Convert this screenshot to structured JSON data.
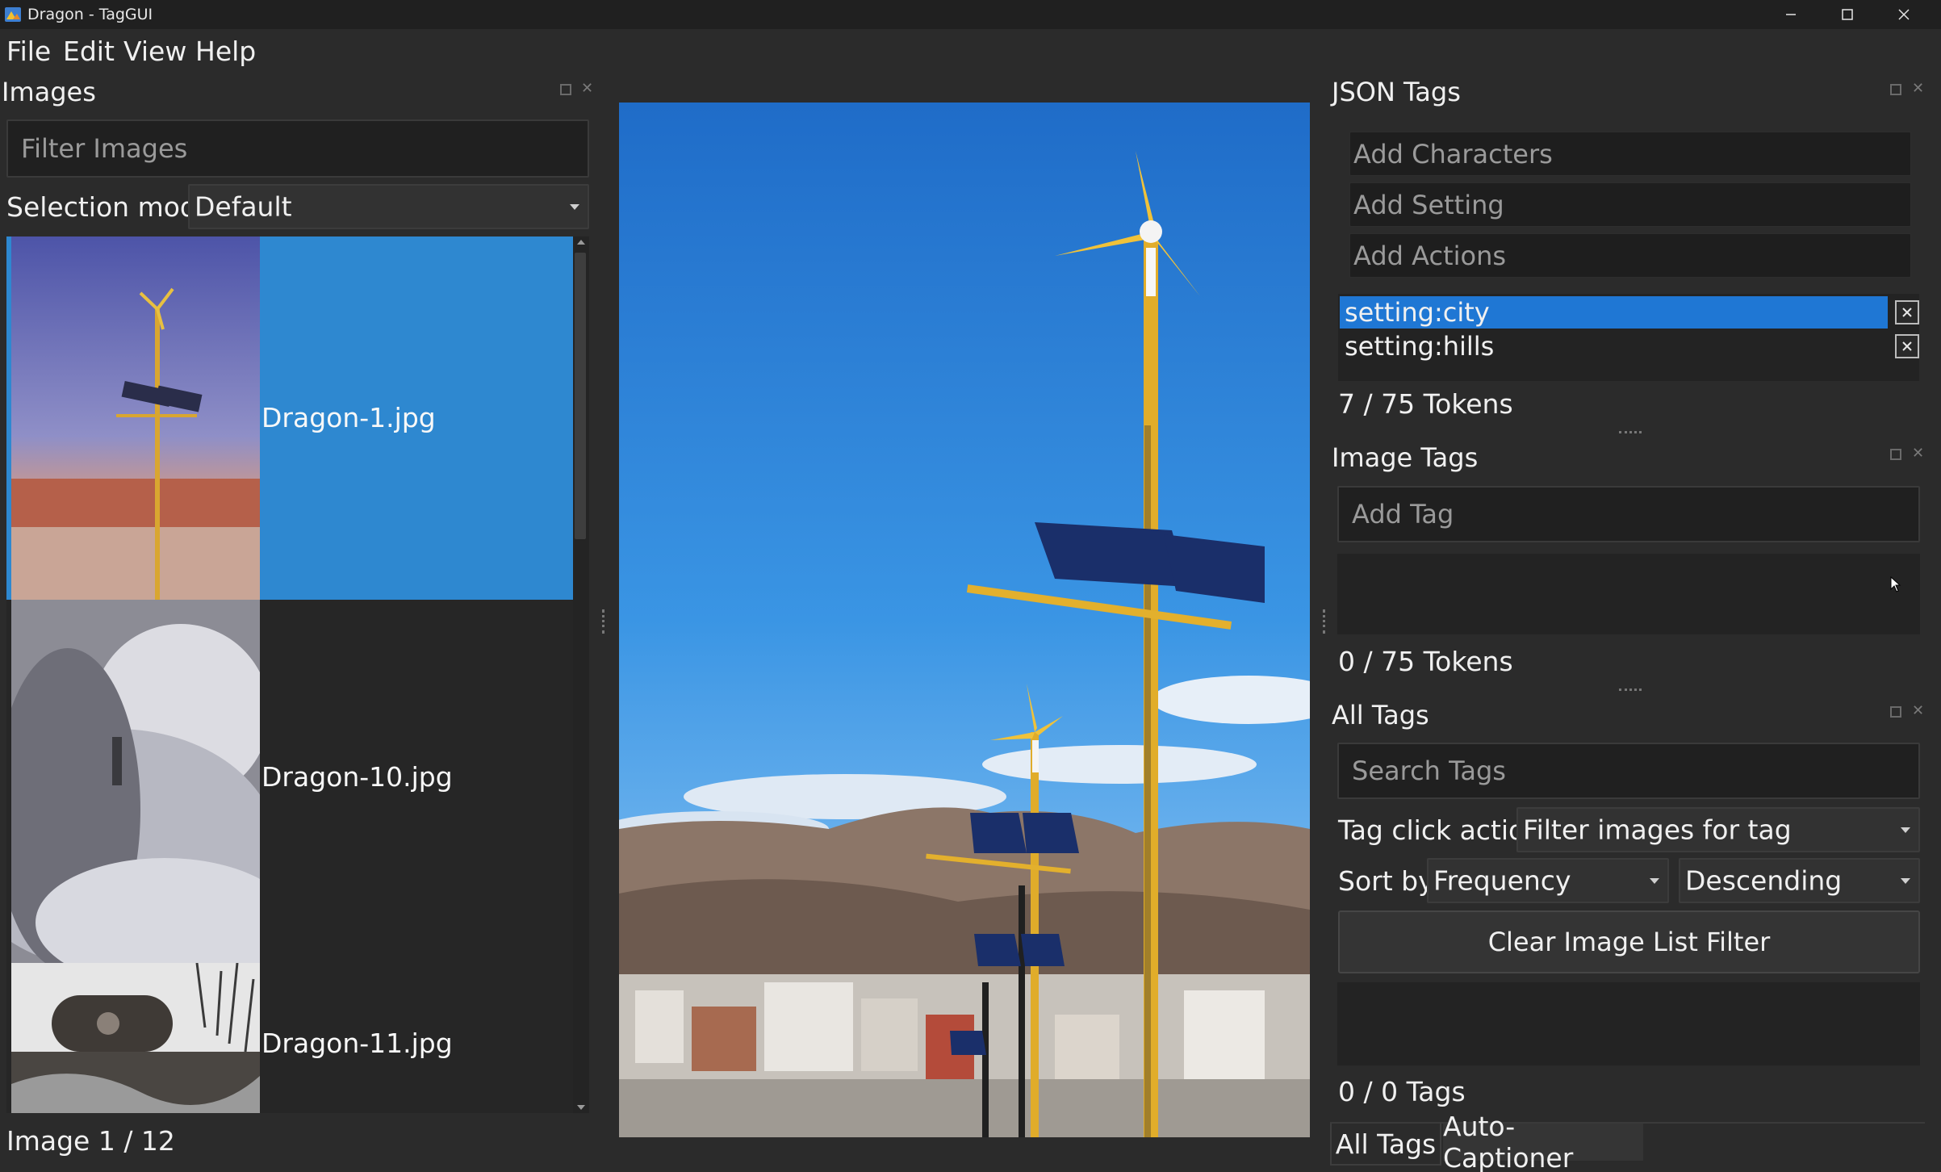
{
  "window": {
    "title": "Dragon - TagGUI"
  },
  "menu": [
    "File",
    "Edit",
    "View",
    "Help"
  ],
  "images_panel": {
    "title": "Images",
    "filter_placeholder": "Filter Images",
    "selection_mode_label": "Selection mode",
    "selection_mode_value": "Default",
    "items": [
      {
        "name": "Dragon-1.jpg",
        "selected": true
      },
      {
        "name": "Dragon-10.jpg",
        "selected": false
      },
      {
        "name": "Dragon-11.jpg",
        "selected": false
      }
    ],
    "status": "Image 1 / 12"
  },
  "json_tags_panel": {
    "title": "JSON Tags",
    "add_characters_placeholder": "Add Characters",
    "add_setting_placeholder": "Add Setting",
    "add_actions_placeholder": "Add Actions",
    "tags": [
      {
        "label": "setting:city",
        "selected": true
      },
      {
        "label": "setting:hills",
        "selected": false
      }
    ],
    "token_count": "7 / 75 Tokens"
  },
  "image_tags_panel": {
    "title": "Image Tags",
    "add_tag_placeholder": "Add Tag",
    "token_count": "0 / 75 Tokens"
  },
  "all_tags_panel": {
    "title": "All Tags",
    "search_placeholder": "Search Tags",
    "tag_click_action_label": "Tag click action",
    "tag_click_action_value": "Filter images for tag",
    "sort_by_label": "Sort by",
    "sort_by_value": "Frequency",
    "sort_order_value": "Descending",
    "clear_filter_label": "Clear Image List Filter",
    "tag_count": "0 / 0 Tags"
  },
  "bottom_tabs": [
    "All Tags",
    "Auto-Captioner"
  ],
  "colors": {
    "selection": "#2e88d0",
    "tag_selection": "#1f77d4",
    "background": "#2b2b2b"
  }
}
